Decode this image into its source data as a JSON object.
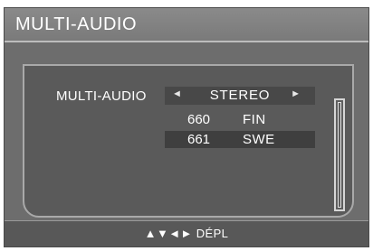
{
  "header": {
    "title": "MULTI-AUDIO"
  },
  "setting": {
    "label": "MULTI-AUDIO",
    "value": "STEREO",
    "left_arrow": "◄",
    "right_arrow": "►"
  },
  "list": {
    "items": [
      {
        "number": "660",
        "code": "FIN"
      },
      {
        "number": "661",
        "code": "SWE"
      }
    ],
    "selected_index": 1
  },
  "footer": {
    "hint": "▲▼◄► DÉPL"
  },
  "colors": {
    "background": "#6d6d6d",
    "title_bar": "#7a7a7a",
    "panel": "#5a5a5a",
    "highlight": "#3f3f3f",
    "text": "#ffffff"
  }
}
